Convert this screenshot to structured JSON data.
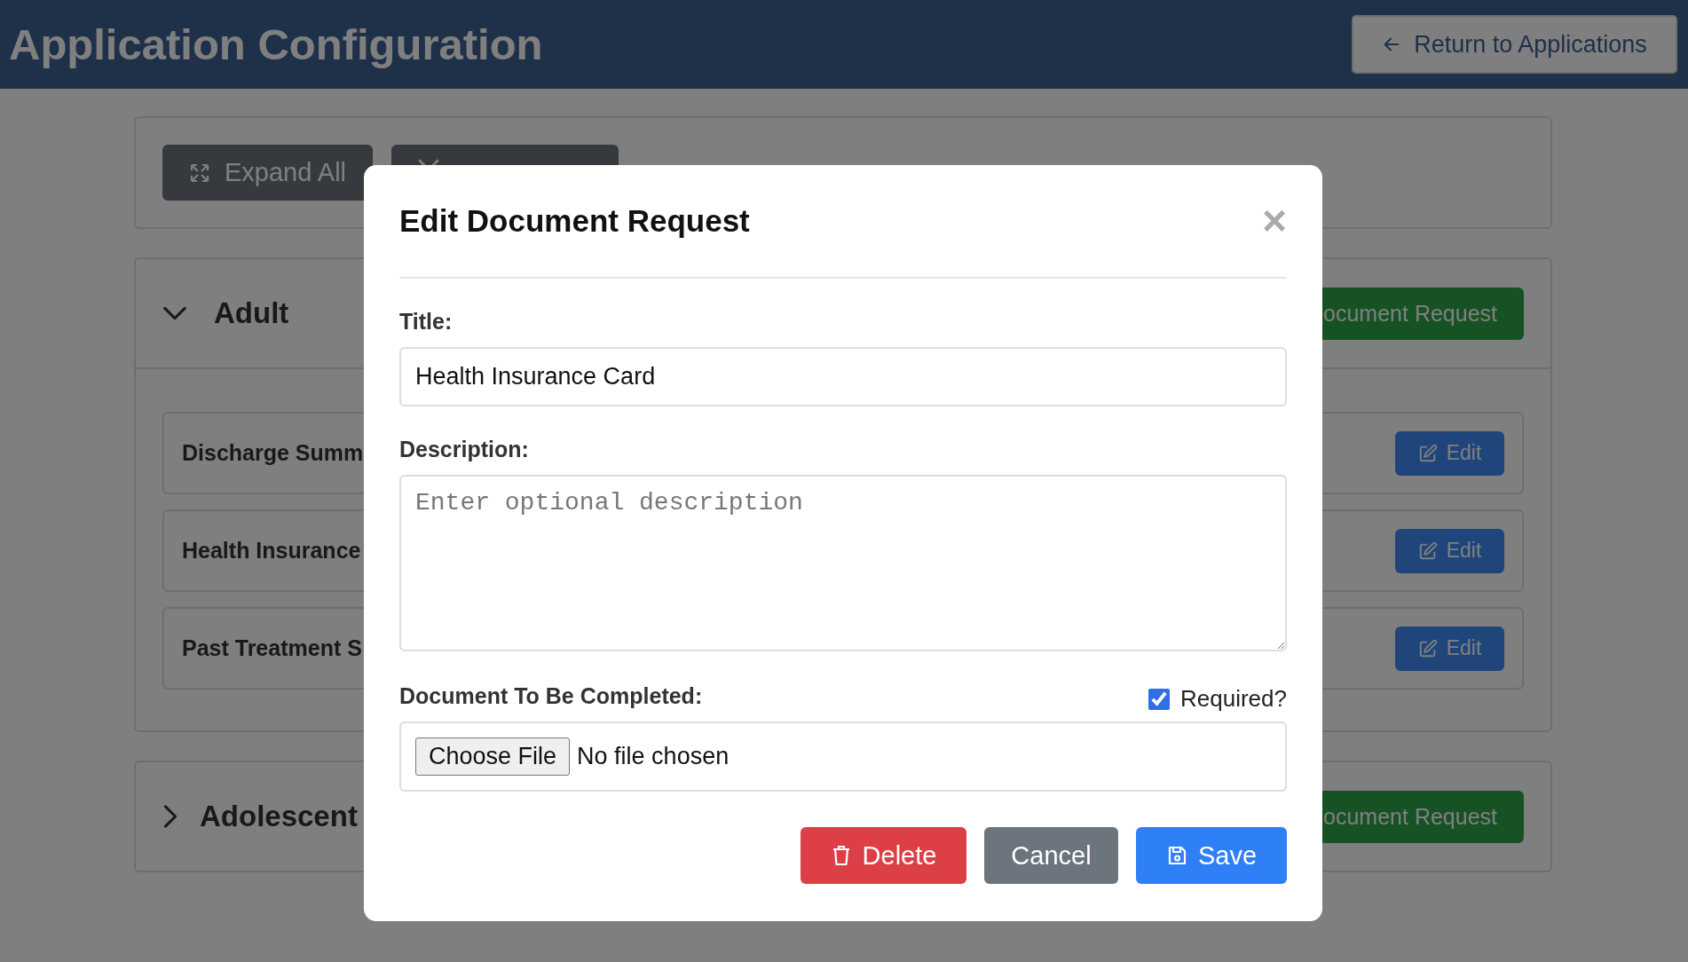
{
  "header": {
    "title": "Application Configuration",
    "back_button": "Return to Applications"
  },
  "toolbar": {
    "expand_button": "Expand All"
  },
  "sections": [
    {
      "title": "Adult",
      "expanded": true,
      "add_button": "ocument Request",
      "items": [
        {
          "title": "Discharge Summ",
          "edit_button": "Edit"
        },
        {
          "title": "Health Insurance",
          "edit_button": "Edit"
        },
        {
          "title": "Past Treatment S",
          "edit_button": "Edit"
        }
      ]
    },
    {
      "title": "Adolescent",
      "expanded": false,
      "add_button": "ocument Request"
    }
  ],
  "modal": {
    "title": "Edit Document Request",
    "close": "×",
    "title_label": "Title:",
    "title_value": "Health Insurance Card",
    "description_label": "Description:",
    "description_placeholder": "Enter optional description",
    "document_label": "Document To Be Completed:",
    "required_label": "Required?",
    "required": true,
    "file_button": "Choose File",
    "file_status": "No file chosen",
    "buttons": [
      {
        "kind": "delete",
        "label": "Delete"
      },
      {
        "kind": "cancel",
        "label": "Cancel"
      },
      {
        "kind": "save",
        "label": "Save"
      }
    ]
  }
}
